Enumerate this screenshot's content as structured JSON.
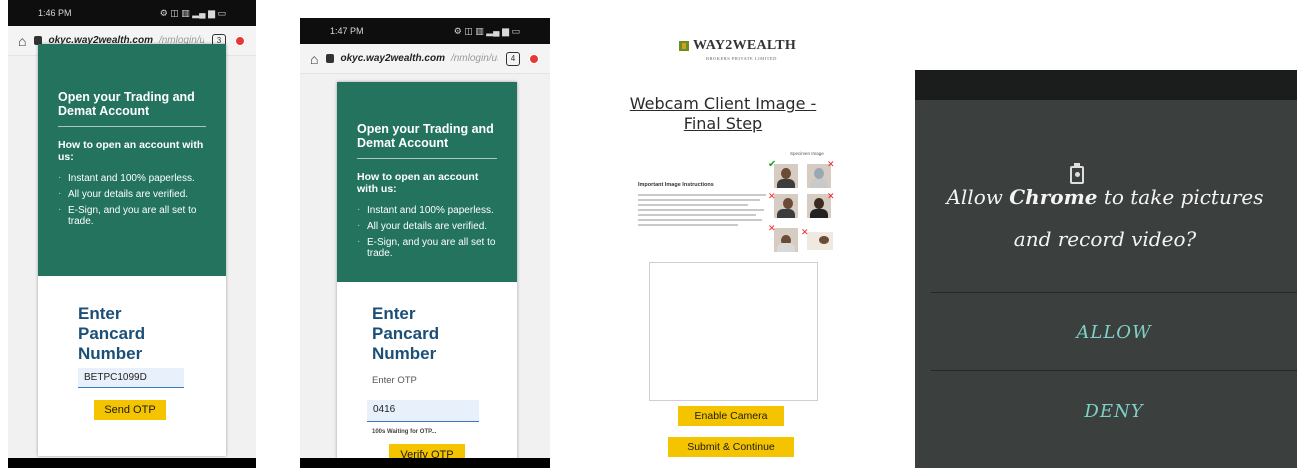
{
  "screen1": {
    "status_time": "1:46 PM",
    "url_domain": "okyc.way2wealth.com",
    "url_path": "/nmlogin/us",
    "tabs_count": "3",
    "heading": "Open your Trading and Demat Account",
    "subheading": "How to open an account with us:",
    "bullets": [
      "Instant and 100% paperless.",
      "All your details are verified.",
      "E-Sign, and you are all set to trade."
    ],
    "pan_title": "Enter Pancard Number",
    "pan_value": "BETPC1099D",
    "send_otp": "Send OTP"
  },
  "screen2": {
    "status_time": "1:47 PM",
    "url_domain": "okyc.way2wealth.com",
    "url_path": "/nmlogin/us",
    "tabs_count": "4",
    "heading": "Open your Trading and Demat Account",
    "subheading": "How to open an account with us:",
    "bullets": [
      "Instant and 100% paperless.",
      "All your details are verified.",
      "E-Sign, and you are all set to trade."
    ],
    "pan_title": "Enter Pancard Number",
    "otp_label": "Enter OTP",
    "otp_value": "0416",
    "waiting": "100s Waiting for OTP...",
    "verify_otp": "Verify OTP"
  },
  "screen3": {
    "brand": "WAY2WEALTH",
    "brand_sub": "BROKERS PRIVATE LIMITED",
    "title": "Webcam Client Image - Final Step",
    "instructions_heading": "Important Image Instructions",
    "sample_label": "Specimen Image",
    "enable_camera": "Enable Camera",
    "submit": "Submit & Continue"
  },
  "screen4": {
    "question_pre": "Allow ",
    "question_app": "Chrome",
    "question_post": " to take pictures and record video?",
    "allow": "ALLOW",
    "deny": "DENY",
    "icon": "camera-permission-icon"
  },
  "colors": {
    "brand_green": "#23735f",
    "button_yellow": "#f5c400",
    "pan_blue": "#1c4f78",
    "dialog_bg": "#3b3f3e",
    "dialog_accent": "#7dd1c7"
  }
}
